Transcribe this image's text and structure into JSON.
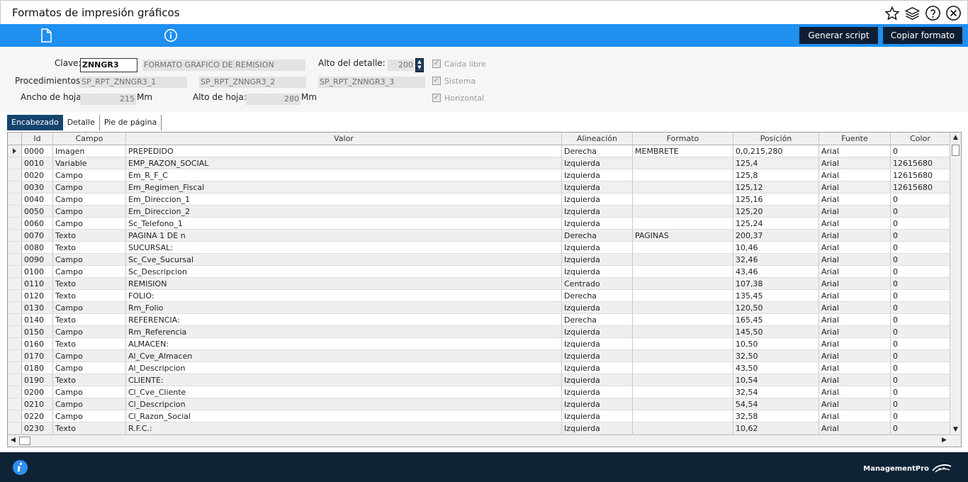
{
  "window": {
    "title": "Formatos de impresión gráficos"
  },
  "toolbar": {
    "generar_label": "Generar script",
    "copiar_label": "Copiar formato"
  },
  "form": {
    "clave_label": "Clave:",
    "clave_value": "ZNNGR3",
    "clave_desc": "FORMATO GRAFICO DE REMISION",
    "alto_detalle_label": "Alto del detalle:",
    "alto_detalle_value": "200",
    "procedimientos_label": "Procedimientos:",
    "proc1": "SP_RPT_ZNNGR3_1",
    "proc2": "SP_RPT_ZNNGR3_2",
    "proc3": "SP_RPT_ZNNGR3_3",
    "ancho_label": "Ancho de hoja:",
    "ancho_value": "215",
    "ancho_unit": "Mm",
    "alto_hoja_label": "Alto de hoja:",
    "alto_hoja_value": "280",
    "alto_hoja_unit": "Mm",
    "caida_libre": "Caída libre",
    "sistema": "Sistema",
    "horizontal": "Horizontal"
  },
  "tabs": [
    {
      "label": "Encabezado",
      "active": true
    },
    {
      "label": "Detalle",
      "active": false
    },
    {
      "label": "Pie de página",
      "active": false
    }
  ],
  "grid": {
    "headers": [
      "Id",
      "Campo",
      "Valor",
      "Alineación",
      "Formato",
      "Posición",
      "Fuente",
      "Color"
    ],
    "rows": [
      [
        "0000",
        "Imagen",
        "PREPEDIDO",
        "Derecha",
        "MEMBRETE",
        "0,0,215,280",
        "Arial",
        "0"
      ],
      [
        "0010",
        "Variable",
        "EMP_RAZON_SOCIAL",
        "Izquierda",
        "",
        "125,4",
        "Arial",
        "12615680"
      ],
      [
        "0020",
        "Campo",
        "Em_R_F_C",
        "Izquierda",
        "",
        "125,8",
        "Arial",
        "12615680"
      ],
      [
        "0030",
        "Campo",
        "Em_Regimen_Fiscal",
        "Izquierda",
        "",
        "125,12",
        "Arial",
        "12615680"
      ],
      [
        "0040",
        "Campo",
        "Em_Direccion_1",
        "Izquierda",
        "",
        "125,16",
        "Arial",
        "0"
      ],
      [
        "0050",
        "Campo",
        "Em_Direccion_2",
        "Izquierda",
        "",
        "125,20",
        "Arial",
        "0"
      ],
      [
        "0060",
        "Campo",
        "Sc_Telefono_1",
        "Izquierda",
        "",
        "125,24",
        "Arial",
        "0"
      ],
      [
        "0070",
        "Texto",
        "PAGINA 1 DE n",
        "Derecha",
        "PAGINAS",
        "200,37",
        "Arial",
        "0"
      ],
      [
        "0080",
        "Texto",
        "SUCURSAL:",
        "Izquierda",
        "",
        "10,46",
        "Arial",
        "0"
      ],
      [
        "0090",
        "Campo",
        "Sc_Cve_Sucursal",
        "Izquierda",
        "",
        "32,46",
        "Arial",
        "0"
      ],
      [
        "0100",
        "Campo",
        "Sc_Descripcion",
        "Izquierda",
        "",
        "43,46",
        "Arial",
        "0"
      ],
      [
        "0110",
        "Texto",
        "REMISION",
        "Centrado",
        "",
        "107,38",
        "Arial",
        "0"
      ],
      [
        "0120",
        "Texto",
        "FOLIO:",
        "Derecha",
        "",
        "135,45",
        "Arial",
        "0"
      ],
      [
        "0130",
        "Campo",
        "Rm_Folio",
        "Izquierda",
        "",
        "120,50",
        "Arial",
        "0"
      ],
      [
        "0140",
        "Texto",
        "REFERENCIA:",
        "Derecha",
        "",
        "165,45",
        "Arial",
        "0"
      ],
      [
        "0150",
        "Campo",
        "Rm_Referencia",
        "Izquierda",
        "",
        "145,50",
        "Arial",
        "0"
      ],
      [
        "0160",
        "Texto",
        "ALMACEN:",
        "Izquierda",
        "",
        "10,50",
        "Arial",
        "0"
      ],
      [
        "0170",
        "Campo",
        "Al_Cve_Almacen",
        "Izquierda",
        "",
        "32,50",
        "Arial",
        "0"
      ],
      [
        "0180",
        "Campo",
        "Al_Descripcion",
        "Izquierda",
        "",
        "43,50",
        "Arial",
        "0"
      ],
      [
        "0190",
        "Texto",
        "CLIENTE:",
        "Izquierda",
        "",
        "10,54",
        "Arial",
        "0"
      ],
      [
        "0200",
        "Campo",
        "Cl_Cve_Cliente",
        "Izquierda",
        "",
        "32,54",
        "Arial",
        "0"
      ],
      [
        "0210",
        "Campo",
        "Cl_Descripcion",
        "Izquierda",
        "",
        "54,54",
        "Arial",
        "0"
      ],
      [
        "0220",
        "Campo",
        "Cl_Razon_Social",
        "Izquierda",
        "",
        "32,58",
        "Arial",
        "0"
      ],
      [
        "0230",
        "Texto",
        "R.F.C.:",
        "Izquierda",
        "",
        "10,62",
        "Arial",
        "0"
      ]
    ]
  },
  "footer": {
    "brand": "ManagementPro"
  },
  "colors": {
    "toolbar_blue": "#1f8ff0",
    "dark_navy": "#0e2336",
    "tab_active": "#14456e"
  }
}
